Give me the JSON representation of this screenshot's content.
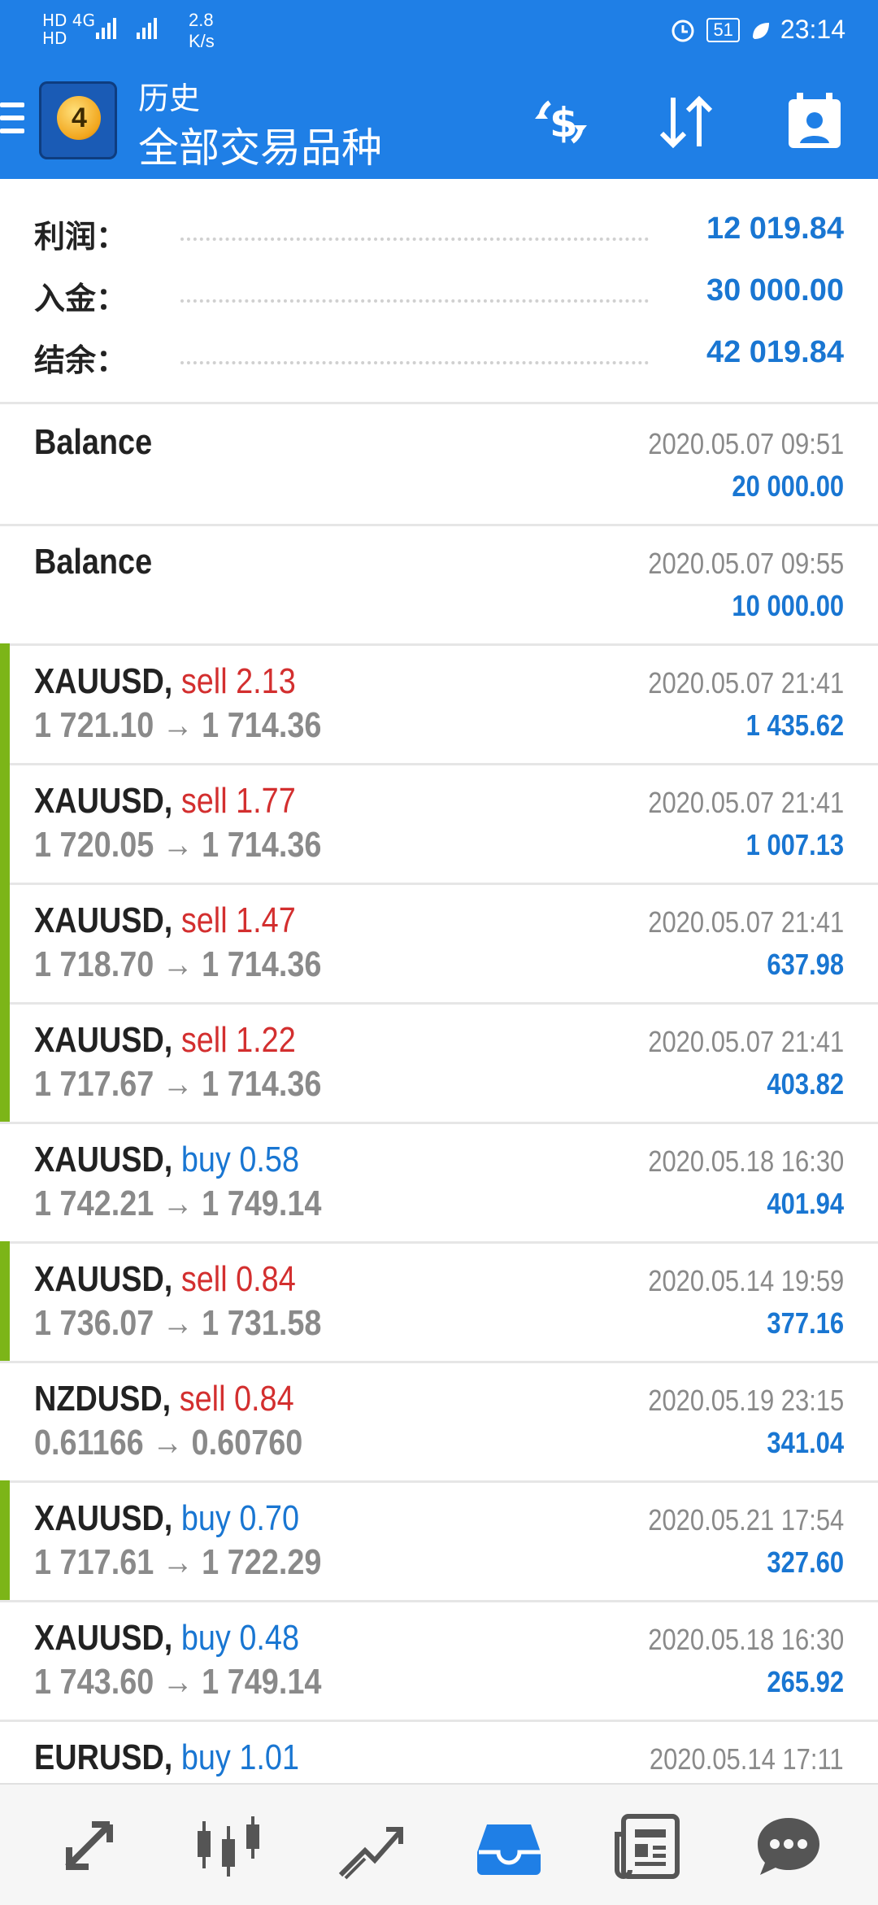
{
  "status_bar": {
    "left_top": "HD 4G",
    "left_bottom": "HD",
    "speed": "2.8",
    "speed_unit": "K/s",
    "battery": "51",
    "time": "23:14"
  },
  "app_bar": {
    "title_small": "历史",
    "title_large": "全部交易品种",
    "logo_number": "4"
  },
  "summary": [
    {
      "label": "利润：",
      "value": "12 019.84"
    },
    {
      "label": "入金：",
      "value": "30 000.00"
    },
    {
      "label": "结余：",
      "value": "42 019.84"
    }
  ],
  "balances": [
    {
      "title": "Balance",
      "date": "2020.05.07 09:51",
      "amount": "20 000.00"
    },
    {
      "title": "Balance",
      "date": "2020.05.07 09:55",
      "amount": "10 000.00"
    }
  ],
  "trades": [
    {
      "symbol": "XAUUSD,",
      "side": "sell 2.13",
      "type": "sell",
      "price": "1 721.10 → 1 714.36",
      "date": "2020.05.07 21:41",
      "profit": "1 435.62",
      "marker": true
    },
    {
      "symbol": "XAUUSD,",
      "side": "sell 1.77",
      "type": "sell",
      "price": "1 720.05 → 1 714.36",
      "date": "2020.05.07 21:41",
      "profit": "1 007.13",
      "marker": true
    },
    {
      "symbol": "XAUUSD,",
      "side": "sell 1.47",
      "type": "sell",
      "price": "1 718.70 → 1 714.36",
      "date": "2020.05.07 21:41",
      "profit": "637.98",
      "marker": true
    },
    {
      "symbol": "XAUUSD,",
      "side": "sell 1.22",
      "type": "sell",
      "price": "1 717.67 → 1 714.36",
      "date": "2020.05.07 21:41",
      "profit": "403.82",
      "marker": true
    },
    {
      "symbol": "XAUUSD,",
      "side": "buy 0.58",
      "type": "buy",
      "price": "1 742.21 → 1 749.14",
      "date": "2020.05.18 16:30",
      "profit": "401.94",
      "marker": false
    },
    {
      "symbol": "XAUUSD,",
      "side": "sell 0.84",
      "type": "sell",
      "price": "1 736.07 → 1 731.58",
      "date": "2020.05.14 19:59",
      "profit": "377.16",
      "marker": true
    },
    {
      "symbol": "NZDUSD,",
      "side": "sell 0.84",
      "type": "sell",
      "price": "0.61166 → 0.60760",
      "date": "2020.05.19 23:15",
      "profit": "341.04",
      "marker": false
    },
    {
      "symbol": "XAUUSD,",
      "side": "buy 0.70",
      "type": "buy",
      "price": "1 717.61 → 1 722.29",
      "date": "2020.05.21 17:54",
      "profit": "327.60",
      "marker": true
    },
    {
      "symbol": "XAUUSD,",
      "side": "buy 0.48",
      "type": "buy",
      "price": "1 743.60 → 1 749.14",
      "date": "2020.05.18 16:30",
      "profit": "265.92",
      "marker": false
    },
    {
      "symbol": "EURUSD,",
      "side": "buy 1.01",
      "type": "buy",
      "price": "",
      "date": "2020.05.14 17:11",
      "profit": "",
      "marker": false
    }
  ],
  "bottom_nav": [
    {
      "icon": "quotes-icon",
      "active": false
    },
    {
      "icon": "chart-icon",
      "active": false
    },
    {
      "icon": "trade-icon",
      "active": false
    },
    {
      "icon": "history-icon",
      "active": true
    },
    {
      "icon": "news-icon",
      "active": false
    },
    {
      "icon": "chat-icon",
      "active": false
    }
  ],
  "colors": {
    "header_bg": "#1f7fe6",
    "sell": "#d32f2f",
    "buy": "#1976d2",
    "profit": "#1976d2",
    "marker": "#7cb518"
  }
}
